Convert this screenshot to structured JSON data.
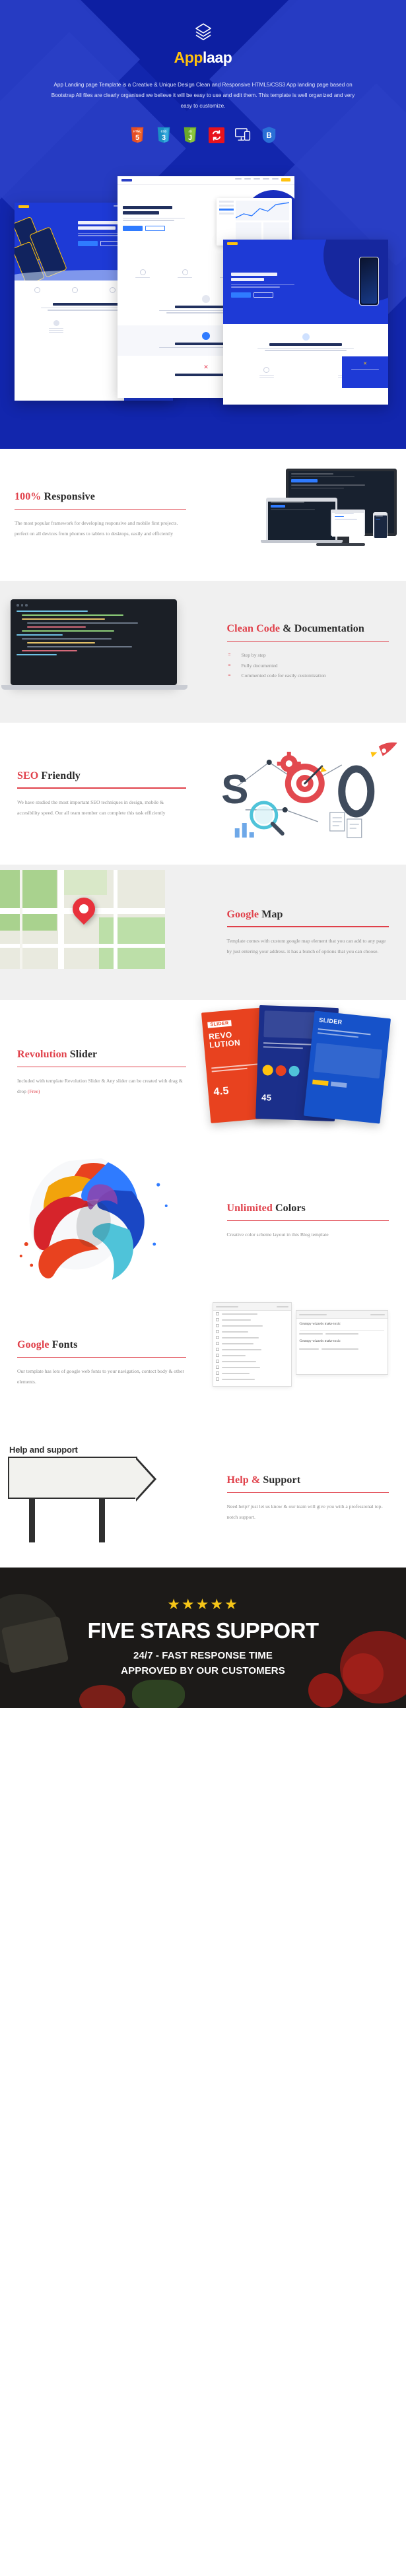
{
  "hero": {
    "logo_icon": "layers-stack-icon",
    "brand_accent": "App",
    "brand_rest": "laap",
    "description": "App Landing page Template is a Creative & Unique Design Clean and Responsive HTML5/CSS3 App landing page based on Bootstrap All files are clearly organised we believe it will be easy to use and edit them. This template is well organized and very easy to customize.",
    "bg_color": "#1226ad",
    "accent_color": "#ffc20e",
    "tech_icons": [
      {
        "name": "html5-icon",
        "label": "HTML",
        "digit": "5",
        "color": "#e44d26"
      },
      {
        "name": "css3-icon",
        "label": "CSS",
        "digit": "3",
        "color": "#29a8d8"
      },
      {
        "name": "jquery-icon",
        "label": "JS",
        "digit": "J",
        "color": "#7fbd36"
      },
      {
        "name": "refresh-sync-icon",
        "label": "",
        "digit": "↻",
        "color": "#e8131d"
      },
      {
        "name": "responsive-devices-icon",
        "label": "",
        "digit": "",
        "color": "#ffffff"
      },
      {
        "name": "bootstrap-icon",
        "label": "",
        "digit": "B",
        "color": "#1f6fd0"
      }
    ]
  },
  "sections": [
    {
      "id": "responsive",
      "title_red": "100%",
      "title_dark": " Responsive",
      "body": "The most popular framework for developing responsive and mobile first projects. perfect on all devices from phomes to tablets to desktops, easily and efficiently",
      "background": "#ffffff",
      "art": "device-mockups-art"
    },
    {
      "id": "clean-code",
      "title_red": "Clean Code",
      "title_dark": " & Documentation",
      "bullets": [
        "Step by step",
        "Fully documented",
        "Commented code for easily customization"
      ],
      "background": "#f0f0f0",
      "art": "laptop-code-art"
    },
    {
      "id": "seo-friendly",
      "title_red": "SEO",
      "title_dark": " Friendly",
      "body": "We have studied the most important SEO techniques in design, mobile & accesibility speed. Our all team member can complete this task efficiently",
      "background": "#ffffff",
      "art": "seo-illustration-art"
    },
    {
      "id": "google-map",
      "title_red": "Google",
      "title_dark": " Map",
      "body": "Template comes with custom google map element that you can add to any page by just entering your address. it has a bunch of options that you can choose.",
      "background": "#f0f0f0",
      "art": "map-pin-art"
    },
    {
      "id": "revolution-slider",
      "title_red": "Revolution",
      "title_dark": " Slider",
      "body": "Included with template Revolution Slider & Any slider can be created with drag & drop ",
      "body_highlight": "(Free)",
      "background": "#ffffff",
      "art": "slider-cards-art"
    },
    {
      "id": "unlimited-colors",
      "title_red": "Unlimited",
      "title_dark": " Colors",
      "body": "Creative color scheme layout in this Blog template",
      "background": "#ffffff",
      "art": "paint-splash-art"
    },
    {
      "id": "google-fonts",
      "title_red": "Google",
      "title_dark": " Fonts",
      "body": "Our template has lots of google web fonts to your navigation, contect body & other elements.",
      "background": "#ffffff",
      "art": "font-picker-art",
      "art_sample_1": "Grumpy wizards make toxic",
      "art_sample_2": "Grumpy wizards make toxic"
    },
    {
      "id": "help-support",
      "title_red": "Help &",
      "title_dark": " Support",
      "body": "Need help? just let us know & our team will give you with a professional top-notch support.",
      "background": "#ffffff",
      "art": "help-signpost-art",
      "art_sign_text": "Help and support"
    }
  ],
  "footer": {
    "stars": "★★★★★",
    "star_count": 5,
    "title": "FIVE STARS SUPPORT",
    "sub_line1": "24/7 - FAST RESPONSE TIME",
    "sub_line2": "APPROVED BY OUR CUSTOMERS",
    "star_color": "#f5c518",
    "bg_color": "#1c1a18"
  },
  "theme": {
    "red": "#e0404a",
    "dark": "#2b2b2b",
    "muted": "#8d8d8d",
    "grey_bg": "#f0f0f0"
  }
}
